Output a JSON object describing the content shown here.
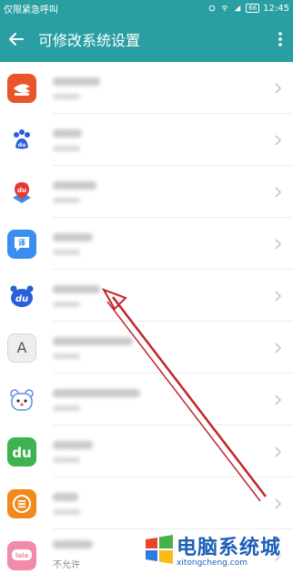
{
  "status_bar": {
    "carrier": "仅限紧急呼叫",
    "battery": "66",
    "time": "12:45"
  },
  "app_bar": {
    "title": "可修改系统设置"
  },
  "apps": [
    {
      "icon": "red-arrow-badge-icon",
      "color": "#e8552b",
      "glyph": "",
      "sub": ""
    },
    {
      "icon": "baidu-paw-icon",
      "color": "#ffffff",
      "glyph": "",
      "sub": ""
    },
    {
      "icon": "baidu-map-pin-icon",
      "color": "#ffffff",
      "glyph": "",
      "sub": ""
    },
    {
      "icon": "baidu-translate-icon",
      "color": "#3a8ef0",
      "glyph": "",
      "sub": ""
    },
    {
      "icon": "baidu-input-du-icon",
      "color": "#ffffff",
      "glyph": "",
      "sub": ""
    },
    {
      "icon": "letter-a-icon",
      "color": "#eeeeee",
      "glyph": "A",
      "sub": ""
    },
    {
      "icon": "bear-face-icon",
      "color": "#ffffff",
      "glyph": "",
      "sub": ""
    },
    {
      "icon": "green-du-icon",
      "color": "#3fb34f",
      "glyph": "",
      "sub": ""
    },
    {
      "icon": "orange-lines-icon",
      "color": "#f08a1c",
      "glyph": "",
      "sub": ""
    },
    {
      "icon": "pink-chat-icon",
      "color": "#f28aa8",
      "glyph": "",
      "sub": "不允许"
    }
  ],
  "watermark": {
    "main": "电脑系统城",
    "url": "xitongcheng.com"
  },
  "colors": {
    "accent": "#2a9fa3",
    "annotation_arrow": "#c0262b"
  }
}
